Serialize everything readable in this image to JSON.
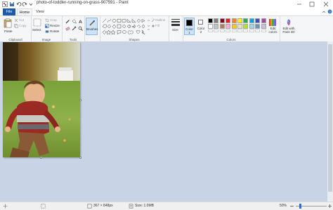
{
  "window": {
    "title": "photo-of-toddler-running-on-grass-907591 - Paint",
    "tabs": {
      "file": "File",
      "home": "Home",
      "view": "View"
    }
  },
  "ribbon": {
    "clipboard": {
      "paste": "Paste",
      "cut": "Cut",
      "copy": "Copy",
      "group": "Clipboard"
    },
    "image": {
      "select": "Select",
      "crop": "Crop",
      "resize": "Resize",
      "rotate": "Rotate",
      "group": "Image"
    },
    "tools": {
      "group": "Tools"
    },
    "brushes": {
      "label": "Brushes"
    },
    "shapes": {
      "outline": "Outline",
      "fill": "Fill",
      "group": "Shapes"
    },
    "size": {
      "label": "Size"
    },
    "colors": {
      "color1": "Color 1",
      "color2": "Color 2",
      "edit_colors": "Edit colors",
      "group": "Colors",
      "color1_value": "#000000",
      "color2_value": "#ffffff",
      "palette_row1": [
        "#000000",
        "#7f7f7f",
        "#880015",
        "#ed1c24",
        "#ff7f27",
        "#fff200",
        "#22b14c",
        "#00a2e8",
        "#3f48cc",
        "#a349a4"
      ],
      "palette_row2": [
        "#ffffff",
        "#c3c3c3",
        "#b97a57",
        "#ffaeC9",
        "#ffc90e",
        "#efe4b0",
        "#b5e61d",
        "#99d9ea",
        "#7092be",
        "#c8bfe7"
      ]
    },
    "paint3d": {
      "label": "Edit with Paint 3D"
    }
  },
  "status": {
    "dimensions": "367 × 848px",
    "size": "Size: 1.0MB",
    "zoom": "50%"
  }
}
